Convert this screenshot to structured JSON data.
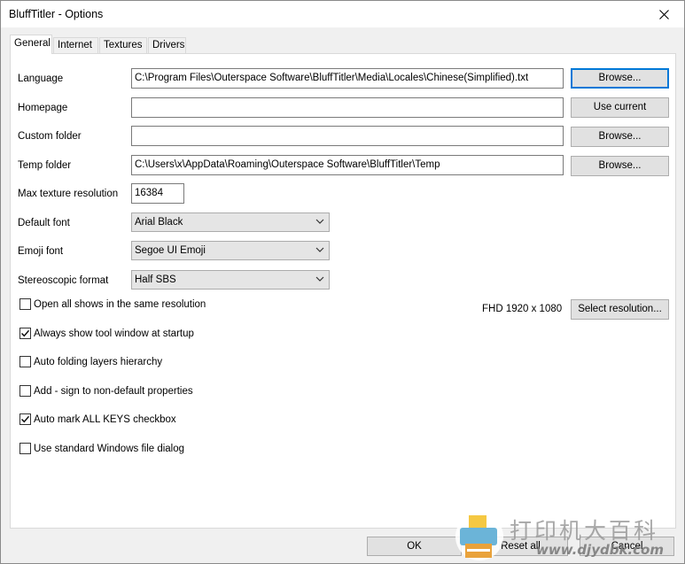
{
  "window": {
    "title": "BluffTitler - Options"
  },
  "tabs": [
    {
      "label": "General"
    },
    {
      "label": "Internet"
    },
    {
      "label": "Textures"
    },
    {
      "label": "Drivers"
    }
  ],
  "general": {
    "language": {
      "label": "Language",
      "value": "C:\\Program Files\\Outerspace Software\\BluffTitler\\Media\\Locales\\Chinese(Simplified).txt",
      "button": "Browse..."
    },
    "homepage": {
      "label": "Homepage",
      "value": "",
      "button": "Use current"
    },
    "custom_folder": {
      "label": "Custom folder",
      "value": "",
      "button": "Browse..."
    },
    "temp_folder": {
      "label": "Temp folder",
      "value": "C:\\Users\\x\\AppData\\Roaming\\Outerspace Software\\BluffTitler\\Temp",
      "button": "Browse..."
    },
    "max_texture": {
      "label": "Max texture resolution",
      "value": "16384"
    },
    "default_font": {
      "label": "Default font",
      "value": "Arial Black"
    },
    "emoji_font": {
      "label": "Emoji font",
      "value": "Segoe UI Emoji"
    },
    "stereo_format": {
      "label": "Stereoscopic format",
      "value": "Half SBS"
    },
    "resolution": {
      "text": "FHD 1920 x 1080",
      "button": "Select resolution..."
    },
    "checkboxes": [
      {
        "label": "Open all shows in the same resolution",
        "checked": false
      },
      {
        "label": "Always show tool window at startup",
        "checked": true
      },
      {
        "label": "Auto folding layers hierarchy",
        "checked": false
      },
      {
        "label": "Add - sign to non-default properties",
        "checked": false
      },
      {
        "label": "Auto mark ALL KEYS checkbox",
        "checked": true
      },
      {
        "label": "Use standard Windows file dialog",
        "checked": false
      }
    ]
  },
  "footer": {
    "ok": "OK",
    "reset_all": "Reset all",
    "cancel": "Cancel"
  },
  "watermark": {
    "cn_text": "打印机大百科",
    "url": "www.djydbk.com"
  }
}
